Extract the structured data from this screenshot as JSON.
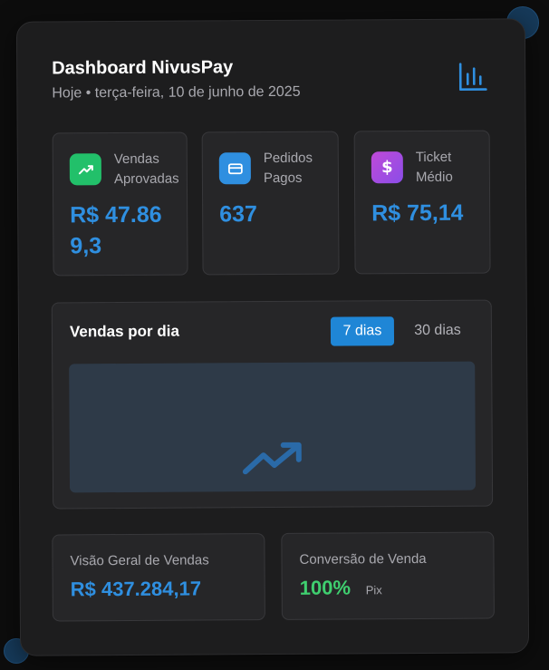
{
  "header": {
    "title": "Dashboard NivusPay",
    "subtitle": "Hoje • terça-feira, 10 de junho de 2025"
  },
  "stats": [
    {
      "label": "Vendas Aprovadas",
      "value": "R$ 47.869,3",
      "icon": "trending-up-icon"
    },
    {
      "label": "Pedidos Pagos",
      "value": "637",
      "icon": "credit-card-icon"
    },
    {
      "label": "Ticket Médio",
      "value": "R$ 75,14",
      "icon": "dollar-icon"
    }
  ],
  "sales_chart": {
    "title": "Vendas por dia",
    "tabs": [
      "7 dias",
      "30 dias"
    ],
    "active_tab": "7 dias"
  },
  "overview": {
    "label": "Visão Geral de Vendas",
    "value": "R$ 437.284,17"
  },
  "conversion": {
    "label": "Conversão de Venda",
    "value": "100%",
    "method": "Pix"
  },
  "colors": {
    "accent": "#2f8fe0",
    "success": "#3fcf6f",
    "tab_active": "#1f86d6",
    "green_icon": "#22c06a",
    "blue_icon": "#2f8fe0",
    "purple_icon": "#a64de0"
  }
}
